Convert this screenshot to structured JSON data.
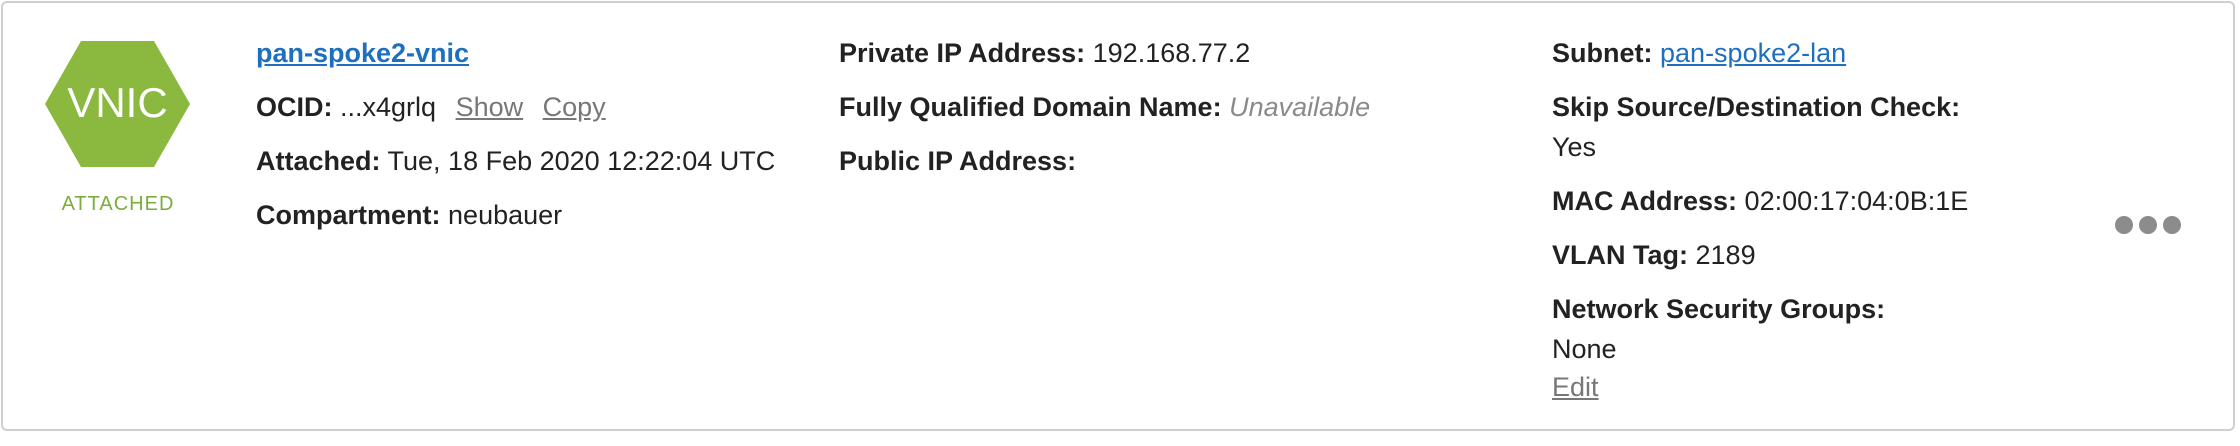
{
  "vnic": {
    "badge_text": "VNIC",
    "status": "ATTACHED",
    "name": "pan-spoke2-vnic",
    "colors": {
      "badge": "#8bb83f",
      "status": "#7aae3c",
      "link": "#1f6fbf"
    }
  },
  "col1": {
    "ocid_label": "OCID:",
    "ocid_value": "...x4grlq",
    "show_label": "Show",
    "copy_label": "Copy",
    "attached_label": "Attached:",
    "attached_value": "Tue, 18 Feb 2020 12:22:04 UTC",
    "compartment_label": "Compartment:",
    "compartment_value": "neubauer"
  },
  "col2": {
    "private_ip_label": "Private IP Address:",
    "private_ip_value": "192.168.77.2",
    "fqdn_label": "Fully Qualified Domain Name:",
    "fqdn_value": "Unavailable",
    "public_ip_label": "Public IP Address:",
    "public_ip_value": ""
  },
  "col3": {
    "subnet_label": "Subnet:",
    "subnet_value": "pan-spoke2-lan",
    "skip_check_label": "Skip Source/Destination Check:",
    "skip_check_value": "Yes",
    "mac_label": "MAC Address:",
    "mac_value": "02:00:17:04:0B:1E",
    "vlan_label": "VLAN Tag:",
    "vlan_value": "2189",
    "nsg_label": "Network Security Groups:",
    "nsg_value": "None",
    "edit_label": "Edit"
  },
  "actions": {
    "menu_icon": "more-horizontal-icon"
  }
}
